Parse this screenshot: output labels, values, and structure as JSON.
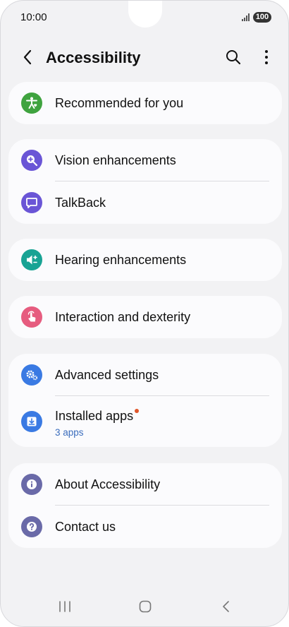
{
  "status_bar": {
    "time": "10:00",
    "battery": "100"
  },
  "header": {
    "title": "Accessibility"
  },
  "groups": [
    {
      "items": [
        {
          "label": "Recommended for you",
          "icon": "accessibility-person-icon",
          "color": "#3fa33f"
        }
      ]
    },
    {
      "items": [
        {
          "label": "Vision enhancements",
          "icon": "magnifier-plus-icon",
          "color": "#6a55d6"
        },
        {
          "label": "TalkBack",
          "icon": "speech-bubble-icon",
          "color": "#6a55d6"
        }
      ]
    },
    {
      "items": [
        {
          "label": "Hearing enhancements",
          "icon": "speaker-plus-minus-icon",
          "color": "#18a394"
        }
      ]
    },
    {
      "items": [
        {
          "label": "Interaction and dexterity",
          "icon": "touch-hand-icon",
          "color": "#e65c7f"
        }
      ]
    },
    {
      "items": [
        {
          "label": "Advanced settings",
          "icon": "gears-icon",
          "color": "#3a7ae3"
        },
        {
          "label": "Installed apps",
          "sub": "3 apps",
          "icon": "download-icon",
          "color": "#3a7ae3",
          "badge": true
        }
      ]
    },
    {
      "items": [
        {
          "label": "About Accessibility",
          "icon": "info-icon",
          "color": "#6a6aa8"
        },
        {
          "label": "Contact us",
          "icon": "question-icon",
          "color": "#6a6aa8"
        }
      ]
    }
  ]
}
